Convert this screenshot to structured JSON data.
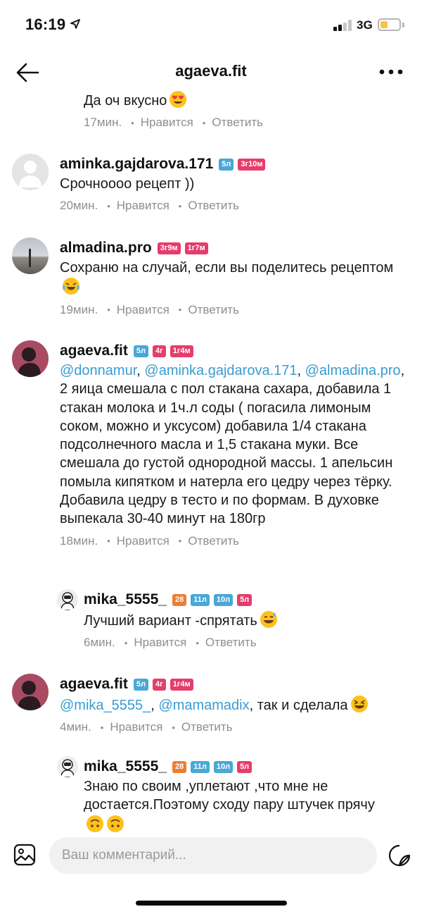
{
  "status_bar": {
    "time": "16:19",
    "network": "3G",
    "battery_level": 0.35,
    "battery_color": "#f6c343"
  },
  "nav": {
    "title": "agaeva.fit",
    "back_icon": "arrow-left-icon",
    "more_icon": "more-horizontal-icon"
  },
  "colors": {
    "mention": "#3a9cd1",
    "badge_blue": "#4aa7d6",
    "badge_pink": "#e63d6b",
    "badge_orange": "#ec7d35"
  },
  "comments": [
    {
      "username": "",
      "badges": [],
      "text": "Да оч вкусно",
      "emoji": "heart-eyes-emoji",
      "time": "17мин.",
      "like": "Нравится",
      "reply": "Ответить"
    },
    {
      "username": "aminka.gajdarova.171",
      "badges": [
        {
          "label": "5л",
          "color": "#4aa7d6"
        },
        {
          "label": "3г10м",
          "color": "#e63d6b"
        }
      ],
      "text": "Срочноооо рецепт ))",
      "time": "20мин.",
      "like": "Нравится",
      "reply": "Ответить"
    },
    {
      "username": "almadina.pro",
      "badges": [
        {
          "label": "3г9м",
          "color": "#e63d6b"
        },
        {
          "label": "1г7м",
          "color": "#e63d6b"
        }
      ],
      "text": "Сохраню на случай, если вы поделитесь рецептом",
      "emoji": "crying-laughing-emoji",
      "time": "19мин.",
      "like": "Нравится",
      "reply": "Ответить"
    },
    {
      "username": "agaeva.fit",
      "badges": [
        {
          "label": "5л",
          "color": "#4aa7d6"
        },
        {
          "label": "4г",
          "color": "#e63d6b"
        },
        {
          "label": "1г4м",
          "color": "#e63d6b"
        }
      ],
      "mentions": [
        "@donnamur",
        "@aminka.gajdarova.171",
        "@almadina.pro"
      ],
      "text": "2 яица смешала с пол стакана сахара, добавила 1 стакан молока и 1ч.л соды ( погасила лимоным соком, можно и уксусом) добавила 1/4 стакана подсолнечного масла и 1,5 стакана муки. Все смешала до густой однородной массы. 1 апельсин помыла кипятком и натерла его цедру через тёрку. Добавила цедру в тесто и по формам. В духовке выпекала 30-40 минут на 180гр",
      "time": "18мин.",
      "like": "Нравится",
      "reply": "Ответить"
    },
    {
      "username": "mika_5555_",
      "badges": [
        {
          "label": "28",
          "color": "#ec7d35"
        },
        {
          "label": "11л",
          "color": "#4aa7d6"
        },
        {
          "label": "10л",
          "color": "#4aa7d6"
        },
        {
          "label": "5л",
          "color": "#e63d6b"
        }
      ],
      "text": "Лучший вариант -спрятать",
      "emoji": "grinning-sweat-emoji",
      "time": "6мин.",
      "like": "Нравится",
      "reply": "Ответить"
    },
    {
      "username": "agaeva.fit",
      "badges": [
        {
          "label": "5л",
          "color": "#4aa7d6"
        },
        {
          "label": "4г",
          "color": "#e63d6b"
        },
        {
          "label": "1г4м",
          "color": "#e63d6b"
        }
      ],
      "mentions": [
        "@mika_5555_",
        "@mamamadix"
      ],
      "text": "так и сделала",
      "emoji": "laughing-emoji",
      "time": "4мин.",
      "like": "Нравится",
      "reply": "Ответить"
    },
    {
      "username": "mika_5555_",
      "badges": [
        {
          "label": "28",
          "color": "#ec7d35"
        },
        {
          "label": "11л",
          "color": "#4aa7d6"
        },
        {
          "label": "10л",
          "color": "#4aa7d6"
        },
        {
          "label": "5л",
          "color": "#e63d6b"
        }
      ],
      "text": "Знаю по своим ,уплетают ,что мне не достается.Поэтому  сходу пару штучек прячу",
      "emoji": "upside-down-face-emoji",
      "time": "",
      "like": "",
      "reply": ""
    }
  ],
  "composer": {
    "placeholder": "Ваш комментарий...",
    "gallery_icon": "image-gallery-icon",
    "sticker_icon": "sticker-icon"
  }
}
